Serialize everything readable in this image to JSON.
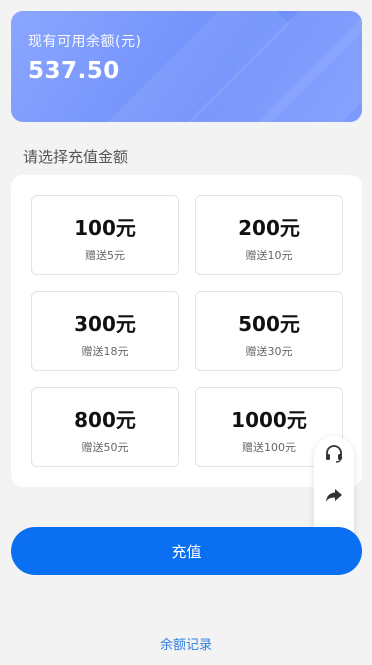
{
  "balance": {
    "label": "现有可用余额(元)",
    "value": "537.50"
  },
  "section_title": "请选择充值金额",
  "options": [
    {
      "amount": "100元",
      "bonus": "赠送5元"
    },
    {
      "amount": "200元",
      "bonus": "赠送10元"
    },
    {
      "amount": "300元",
      "bonus": "赠送18元"
    },
    {
      "amount": "500元",
      "bonus": "赠送30元"
    },
    {
      "amount": "800元",
      "bonus": "赠送50元"
    },
    {
      "amount": "1000元",
      "bonus": "赠送100元"
    }
  ],
  "float_actions": [
    {
      "icon": "headset-icon"
    },
    {
      "icon": "share-icon"
    },
    {
      "icon": "home-icon"
    }
  ],
  "recharge_button": "充值",
  "history_link": "余额记录",
  "colors": {
    "primary": "#0a6ff0",
    "card_gradient_start": "#8aa6ff",
    "card_gradient_end": "#6f8ffb",
    "link": "#2f7fe0"
  }
}
